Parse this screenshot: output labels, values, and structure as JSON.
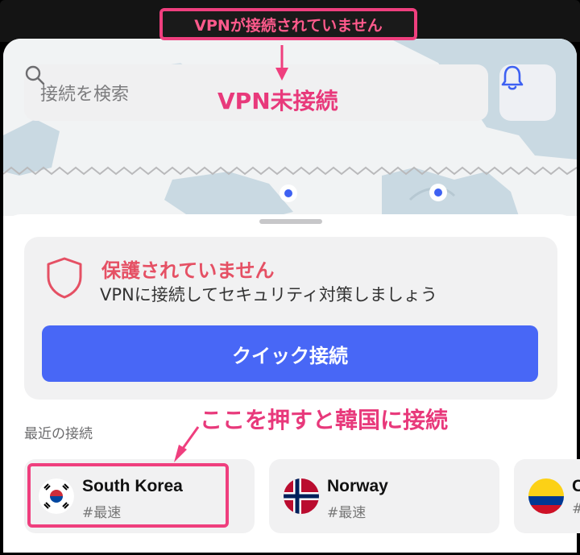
{
  "status_banner": {
    "text": "VPNが接続されていません"
  },
  "search": {
    "placeholder": "接続を検索"
  },
  "annotations": {
    "vpn_not_connected": "VPN未接続",
    "tap_korea": "ここを押すと韓国に接続"
  },
  "protection": {
    "title": "保護されていません",
    "description": "VPNに接続してセキュリティ対策しましょう",
    "quick_connect_label": "クイック接続"
  },
  "recent": {
    "label": "最近の接続",
    "servers": [
      {
        "name": "South Korea",
        "tag": "#最速"
      },
      {
        "name": "Norway",
        "tag": "#最速"
      },
      {
        "name": "C",
        "tag": "#"
      }
    ]
  },
  "colors": {
    "accent": "#4867f6",
    "warning": "#e55064",
    "annotation": "#e8397b"
  },
  "icons": {
    "search": "search-icon",
    "bell": "bell-icon",
    "shield": "shield-icon"
  }
}
